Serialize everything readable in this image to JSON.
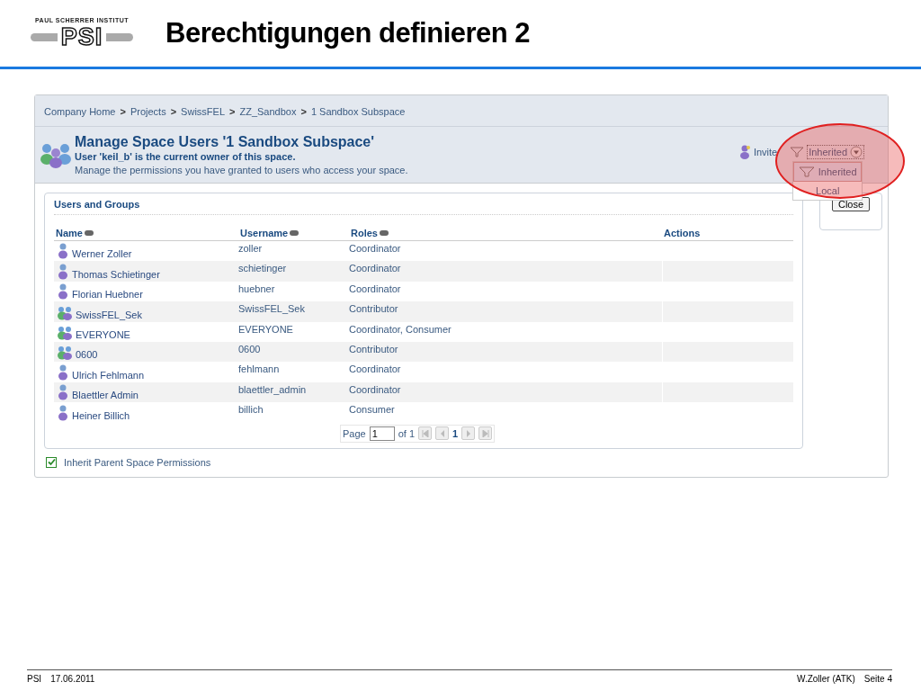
{
  "slide": {
    "logo_caption": "PAUL SCHERRER INSTITUT",
    "logo_letters": "PSI",
    "title": "Berechtigungen definieren 2"
  },
  "breadcrumb": [
    "Company Home",
    "Projects",
    "SwissFEL",
    "ZZ_Sandbox",
    "1 Sandbox Subspace"
  ],
  "breadcrumb_separator": ">",
  "header": {
    "title": "Manage Space Users '1 Sandbox Subspace'",
    "owner": "User 'keil_b' is the current owner of this space.",
    "description": "Manage the permissions you have granted to users who access your space."
  },
  "invite": "Invite",
  "filter": {
    "value": "Inherited",
    "options": [
      {
        "label": "Inherited",
        "selected": true
      },
      {
        "label": "Local",
        "selected": false
      }
    ]
  },
  "close_button": "Close",
  "panel_title": "Users and Groups",
  "columns": [
    {
      "label": "Name",
      "sortable": true
    },
    {
      "label": "Username",
      "sortable": true
    },
    {
      "label": "Roles",
      "sortable": true
    },
    {
      "label": "Actions",
      "sortable": false
    }
  ],
  "rows": [
    {
      "kind": "user",
      "name": "Werner Zoller",
      "username": "zoller",
      "roles": "Coordinator"
    },
    {
      "kind": "user",
      "name": "Thomas Schietinger",
      "username": "schietinger",
      "roles": "Coordinator"
    },
    {
      "kind": "user",
      "name": "Florian Huebner",
      "username": "huebner",
      "roles": "Coordinator"
    },
    {
      "kind": "group",
      "name": "SwissFEL_Sek",
      "username": "SwissFEL_Sek",
      "roles": "Contributor"
    },
    {
      "kind": "group",
      "name": "EVERYONE",
      "username": "EVERYONE",
      "roles": "Coordinator, Consumer"
    },
    {
      "kind": "group",
      "name": "0600",
      "username": "0600",
      "roles": "Contributor"
    },
    {
      "kind": "user",
      "name": "Ulrich Fehlmann",
      "username": "fehlmann",
      "roles": "Coordinator"
    },
    {
      "kind": "user",
      "name": "Blaettler Admin",
      "username": "blaettler_admin",
      "roles": "Coordinator"
    },
    {
      "kind": "user",
      "name": "Heiner Billich",
      "username": "billich",
      "roles": "Consumer"
    }
  ],
  "pager": {
    "label": "Page",
    "value": "1",
    "of": "of 1",
    "current": "1"
  },
  "inherit": {
    "label": "Inherit Parent Space Permissions",
    "checked": true
  },
  "footer": {
    "left": "PSI",
    "date": "17.06.2011",
    "author": "W.Zoller (ATK)",
    "page": "Seite 4"
  }
}
